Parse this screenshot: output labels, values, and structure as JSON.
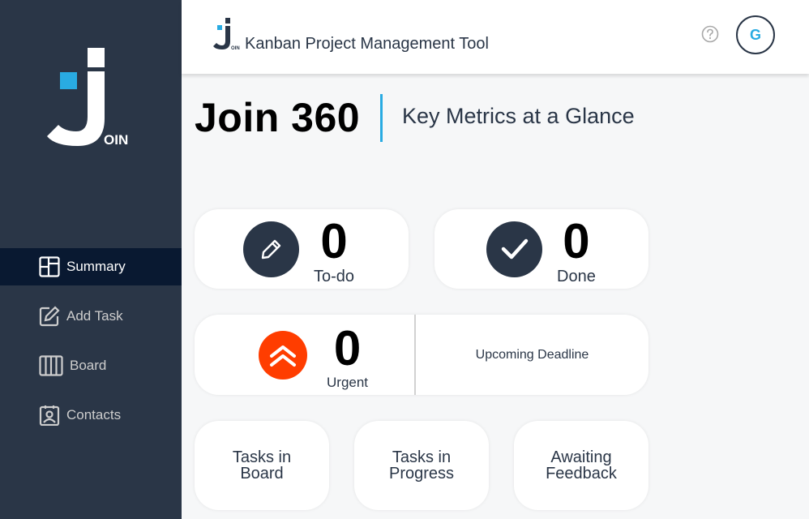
{
  "app": {
    "title": "Kanban Project Management Tool",
    "logo_text": "OIN",
    "user_initial": "G"
  },
  "sidebar": {
    "items": [
      {
        "label": "Summary",
        "icon": "summary-icon",
        "active": true
      },
      {
        "label": "Add Task",
        "icon": "edit-icon",
        "active": false
      },
      {
        "label": "Board",
        "icon": "board-icon",
        "active": false
      },
      {
        "label": "Contacts",
        "icon": "contacts-icon",
        "active": false
      }
    ]
  },
  "main": {
    "title": "Join 360",
    "subtitle": "Key Metrics at a Glance",
    "todo": {
      "count": "0",
      "label": "To-do"
    },
    "done": {
      "count": "0",
      "label": "Done"
    },
    "urgent": {
      "count": "0",
      "label": "Urgent"
    },
    "deadline": {
      "label": "Upcoming Deadline"
    },
    "tasks_in_board": {
      "line1": "Tasks in",
      "line2": "Board"
    },
    "tasks_in_progress": {
      "line1": "Tasks in",
      "line2": "Progress"
    },
    "awaiting_feedback": {
      "line1": "Awaiting",
      "line2": "Feedback"
    }
  },
  "colors": {
    "sidebar_bg": "#2a3647",
    "sidebar_active": "#091931",
    "accent": "#29abe2",
    "urgent": "#ff3d00"
  }
}
